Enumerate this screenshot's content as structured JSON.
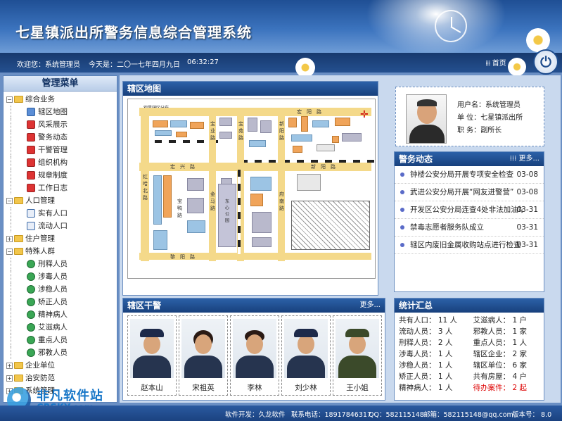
{
  "app": {
    "title": "七星镇派出所警务信息综合管理系统"
  },
  "topbar": {
    "welcome": "欢迎您：系统管理员",
    "today": "今天是：二〇一七年四月九日",
    "time": "06:32:27",
    "home": "首页"
  },
  "sidebar": {
    "title": "管理菜单",
    "groups": [
      {
        "label": "综合业务",
        "expanded": true,
        "items": [
          "辖区地图",
          "风采展示",
          "警务动态",
          "干警管理",
          "组织机构",
          "规章制度",
          "工作日志"
        ]
      },
      {
        "label": "人口管理",
        "expanded": true,
        "items": [
          "实有人口",
          "流动人口"
        ]
      },
      {
        "label": "住户管理",
        "expanded": false,
        "items": []
      },
      {
        "label": "特殊人群",
        "expanded": true,
        "items": [
          "刑释人员",
          "涉毒人员",
          "涉稳人员",
          "矫正人员",
          "精神病人",
          "艾滋病人",
          "重点人员",
          "邪教人员"
        ]
      },
      {
        "label": "企业单位",
        "expanded": false,
        "items": []
      },
      {
        "label": "治安防范",
        "expanded": false,
        "items": []
      },
      {
        "label": "系统管理",
        "expanded": false,
        "items": []
      }
    ]
  },
  "map_panel": {
    "title": "辖区地图",
    "labels": [
      "观里辖区分布",
      "宏",
      "阳",
      "路",
      "红",
      "哈",
      "北",
      "路",
      "宏",
      "兴",
      "路",
      "新",
      "阳",
      "路",
      "黎",
      "阳",
      "路",
      "宝",
      "业",
      "路",
      "宝",
      "苑",
      "路",
      "新",
      "阳",
      "路",
      "金",
      "马",
      "路",
      "府",
      "南",
      "路",
      "宝",
      "鸭",
      "路",
      "东",
      "心",
      "公",
      "园"
    ]
  },
  "cadres_panel": {
    "title": "辖区干警",
    "more": "更多...",
    "names": [
      "赵本山",
      "宋祖英",
      "李林",
      "刘少林",
      "王小姐"
    ]
  },
  "profile": {
    "username_label": "用户名：",
    "username": "系统管理员",
    "unit_label": "单  位：",
    "unit": "七星镇派出所",
    "position_label": "职  务：",
    "position": "副所长"
  },
  "news_panel": {
    "title": "警务动态",
    "more": "更多...",
    "items": [
      {
        "title": "钟楼公安分局开展专项安全检查",
        "date": "03-08"
      },
      {
        "title": "武进公安分局开展“网友进警营”",
        "date": "03-08"
      },
      {
        "title": "开发区公安分局连查4处非法加油站",
        "date": "03-31"
      },
      {
        "title": "禁毒志愿者服务队成立",
        "date": "03-31"
      },
      {
        "title": "辖区内废旧金属收购站点进行检查",
        "date": "03-31"
      }
    ]
  },
  "stats_panel": {
    "title": "统计汇总",
    "left": [
      "共有人口： 11 人",
      "流动人员： 3 人",
      "刑释人员： 2 人",
      "涉毒人员： 1 人",
      "涉稳人员： 1 人",
      "矫正人员： 1 人",
      "精神病人： 1 人"
    ],
    "right": [
      "艾滋病人： 1 户",
      "邪教人员： 1 家",
      "重点人员： 1 人",
      "辖区企业： 2 家",
      "辖区单位： 6 家",
      "共有房屋： 4 户",
      "待办案件： 2 起"
    ]
  },
  "footer": {
    "dev": "软件开发：久龙软件",
    "phone": "联系电话：18917846317",
    "qq": "QQ：582115148",
    "email": "邮箱：582115148@qq.com",
    "version": "版本号： 8.0"
  },
  "watermark": {
    "line1": "非凡软件站",
    "line2": "CRSKY.com"
  }
}
